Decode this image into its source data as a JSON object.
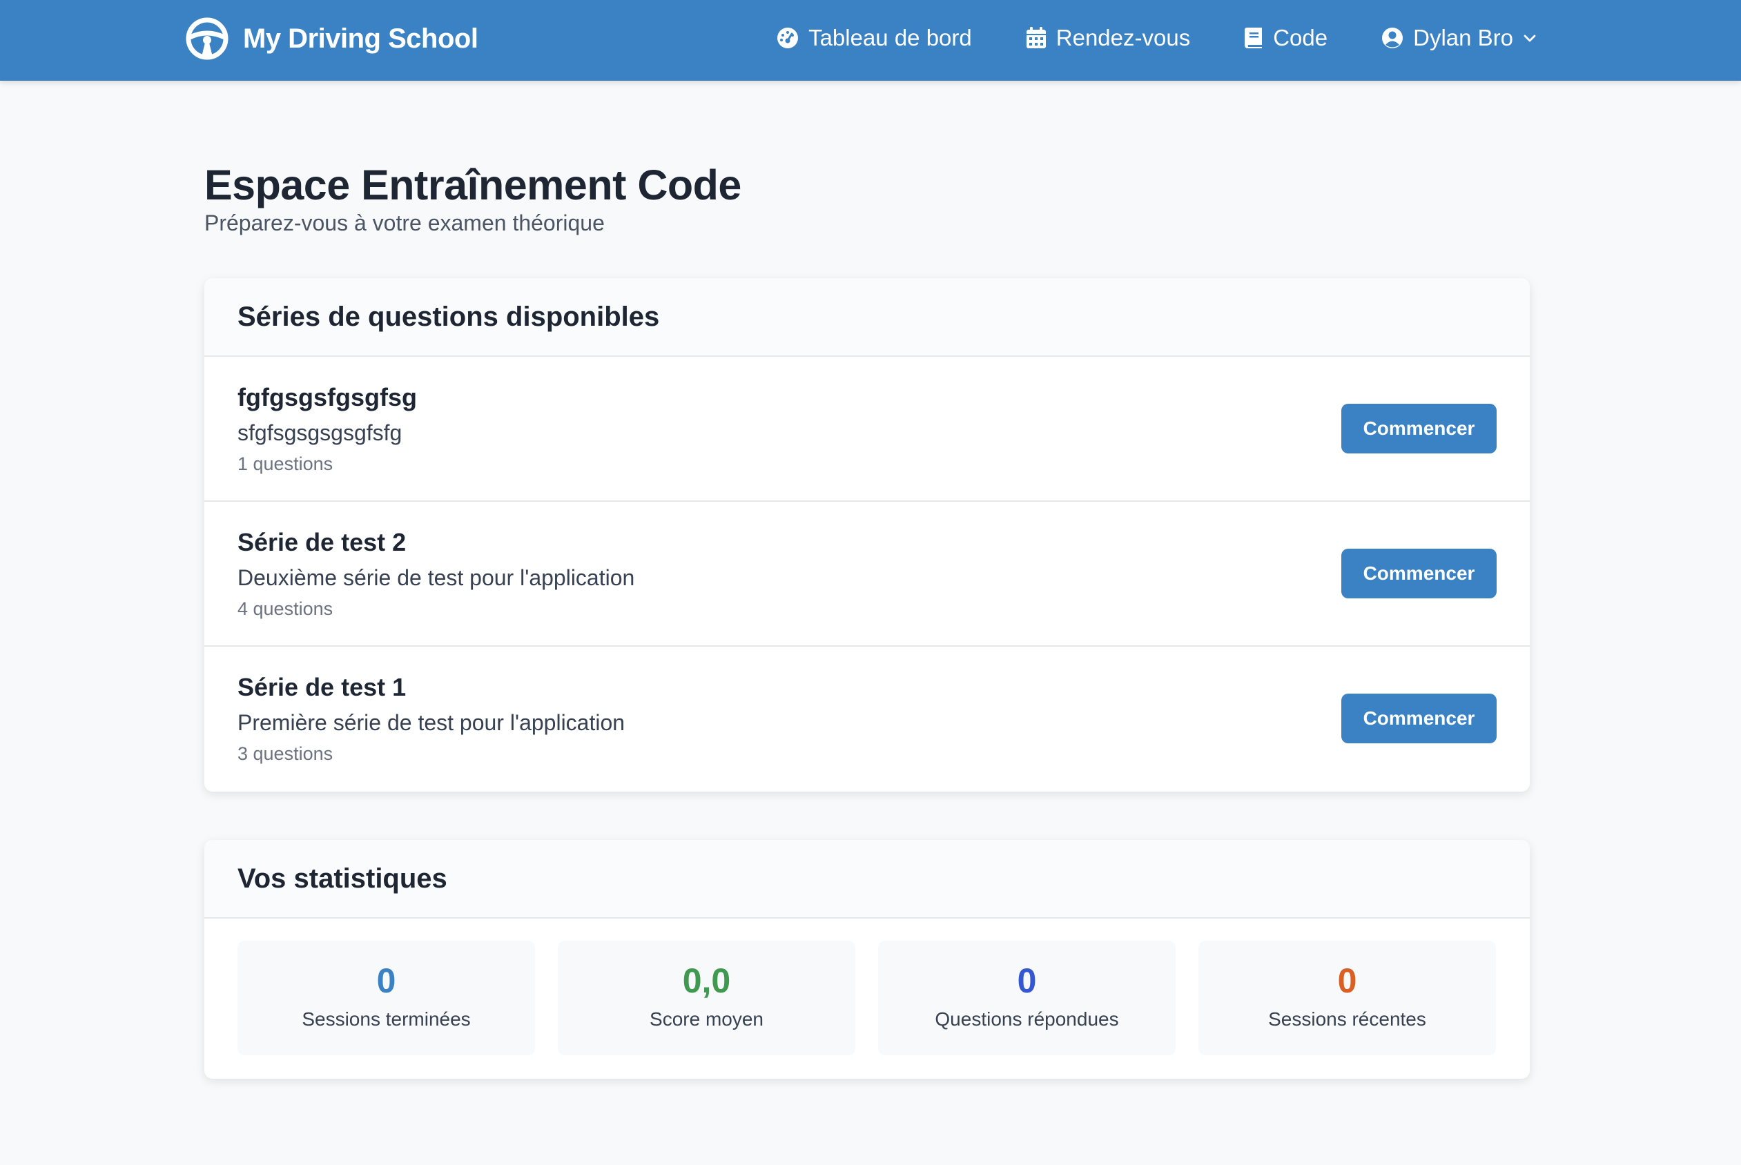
{
  "app": {
    "brand": "My Driving School"
  },
  "nav": {
    "items": [
      {
        "label": "Tableau de bord",
        "icon": "tachometer-icon"
      },
      {
        "label": "Rendez-vous",
        "icon": "calendar-icon"
      },
      {
        "label": "Code",
        "icon": "book-icon"
      }
    ],
    "user": {
      "label": "Dylan Bro",
      "icon": "user-circle-icon",
      "dropdown_icon": "chevron-down-icon"
    }
  },
  "page": {
    "title": "Espace Entraînement Code",
    "subtitle": "Préparez-vous à votre examen théorique"
  },
  "series_card": {
    "title": "Séries de questions disponibles",
    "items": [
      {
        "name": "fgfgsgsfgsgfsg",
        "description": "sfgfsgsgsgsgfsfg",
        "count": "1 questions",
        "button": "Commencer"
      },
      {
        "name": "Série de test 2",
        "description": "Deuxième série de test pour l'application",
        "count": "4 questions",
        "button": "Commencer"
      },
      {
        "name": "Série de test 1",
        "description": "Première série de test pour l'application",
        "count": "3 questions",
        "button": "Commencer"
      }
    ]
  },
  "stats_card": {
    "title": "Vos statistiques",
    "items": [
      {
        "value": "0",
        "label": "Sessions terminées",
        "color": "#3a82c4"
      },
      {
        "value": "0,0",
        "label": "Score moyen",
        "color": "#3f9a4f"
      },
      {
        "value": "0",
        "label": "Questions répondues",
        "color": "#3557d1"
      },
      {
        "value": "0",
        "label": "Sessions récentes",
        "color": "#d95f25"
      }
    ]
  },
  "colors": {
    "primary": "#3a82c4",
    "background": "#f8f9fb"
  }
}
